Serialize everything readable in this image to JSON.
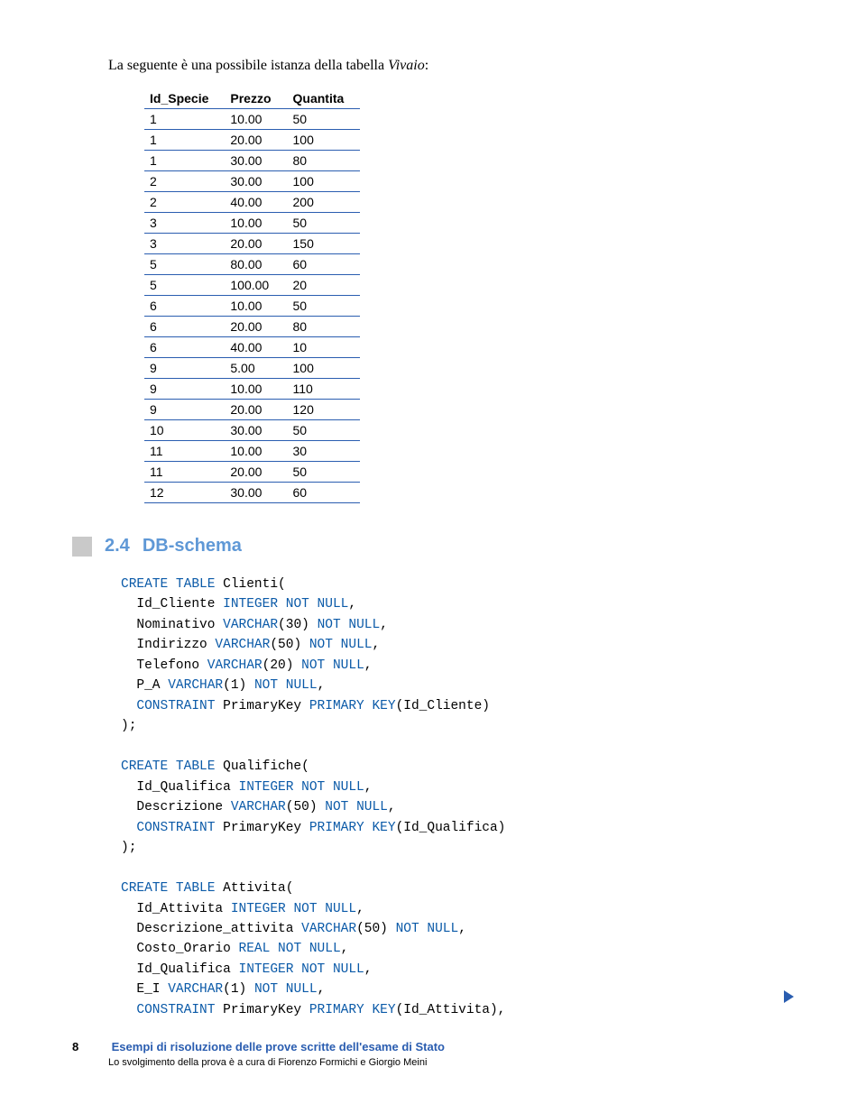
{
  "intro": {
    "prefix": "La seguente è una possibile istanza della tabella ",
    "italic": "Vivaio",
    "suffix": ":"
  },
  "table": {
    "headers": [
      "Id_Specie",
      "Prezzo",
      "Quantita"
    ],
    "rows": [
      [
        "1",
        "10.00",
        "50"
      ],
      [
        "1",
        "20.00",
        "100"
      ],
      [
        "1",
        "30.00",
        "80"
      ],
      [
        "2",
        "30.00",
        "100"
      ],
      [
        "2",
        "40.00",
        "200"
      ],
      [
        "3",
        "10.00",
        "50"
      ],
      [
        "3",
        "20.00",
        "150"
      ],
      [
        "5",
        "80.00",
        "60"
      ],
      [
        "5",
        "100.00",
        "20"
      ],
      [
        "6",
        "10.00",
        "50"
      ],
      [
        "6",
        "20.00",
        "80"
      ],
      [
        "6",
        "40.00",
        "10"
      ],
      [
        "9",
        "5.00",
        "100"
      ],
      [
        "9",
        "10.00",
        "110"
      ],
      [
        "9",
        "20.00",
        "120"
      ],
      [
        "10",
        "30.00",
        "50"
      ],
      [
        "11",
        "10.00",
        "30"
      ],
      [
        "11",
        "20.00",
        "50"
      ],
      [
        "12",
        "30.00",
        "60"
      ]
    ]
  },
  "section": {
    "number": "2.4",
    "title": "DB-schema"
  },
  "code": {
    "lines": [
      [
        [
          "kw",
          "CREATE TABLE"
        ],
        [
          "",
          " Clienti("
        ]
      ],
      [
        [
          "",
          "  Id_Cliente "
        ],
        [
          "kw",
          "INTEGER NOT NULL"
        ],
        [
          "",
          ","
        ]
      ],
      [
        [
          "",
          "  Nominativo "
        ],
        [
          "kw",
          "VARCHAR"
        ],
        [
          "",
          "(30) "
        ],
        [
          "kw",
          "NOT NULL"
        ],
        [
          "",
          ","
        ]
      ],
      [
        [
          "",
          "  Indirizzo "
        ],
        [
          "kw",
          "VARCHAR"
        ],
        [
          "",
          "(50) "
        ],
        [
          "kw",
          "NOT NULL"
        ],
        [
          "",
          ","
        ]
      ],
      [
        [
          "",
          "  Telefono "
        ],
        [
          "kw",
          "VARCHAR"
        ],
        [
          "",
          "(20) "
        ],
        [
          "kw",
          "NOT NULL"
        ],
        [
          "",
          ","
        ]
      ],
      [
        [
          "",
          "  P_A "
        ],
        [
          "kw",
          "VARCHAR"
        ],
        [
          "",
          "(1) "
        ],
        [
          "kw",
          "NOT NULL"
        ],
        [
          "",
          ","
        ]
      ],
      [
        [
          "",
          "  "
        ],
        [
          "kw",
          "CONSTRAINT"
        ],
        [
          "",
          " PrimaryKey "
        ],
        [
          "kw",
          "PRIMARY KEY"
        ],
        [
          "",
          "(Id_Cliente)"
        ]
      ],
      [
        [
          "",
          ");"
        ]
      ],
      [
        [
          "",
          ""
        ]
      ],
      [
        [
          "kw",
          "CREATE TABLE"
        ],
        [
          "",
          " Qualifiche("
        ]
      ],
      [
        [
          "",
          "  Id_Qualifica "
        ],
        [
          "kw",
          "INTEGER NOT NULL"
        ],
        [
          "",
          ","
        ]
      ],
      [
        [
          "",
          "  Descrizione "
        ],
        [
          "kw",
          "VARCHAR"
        ],
        [
          "",
          "(50) "
        ],
        [
          "kw",
          "NOT NULL"
        ],
        [
          "",
          ","
        ]
      ],
      [
        [
          "",
          "  "
        ],
        [
          "kw",
          "CONSTRAINT"
        ],
        [
          "",
          " PrimaryKey "
        ],
        [
          "kw",
          "PRIMARY KEY"
        ],
        [
          "",
          "(Id_Qualifica)"
        ]
      ],
      [
        [
          "",
          ");"
        ]
      ],
      [
        [
          "",
          ""
        ]
      ],
      [
        [
          "kw",
          "CREATE TABLE"
        ],
        [
          "",
          " Attivita("
        ]
      ],
      [
        [
          "",
          "  Id_Attivita "
        ],
        [
          "kw",
          "INTEGER NOT NULL"
        ],
        [
          "",
          ","
        ]
      ],
      [
        [
          "",
          "  Descrizione_attivita "
        ],
        [
          "kw",
          "VARCHAR"
        ],
        [
          "",
          "(50) "
        ],
        [
          "kw",
          "NOT NULL"
        ],
        [
          "",
          ","
        ]
      ],
      [
        [
          "",
          "  Costo_Orario "
        ],
        [
          "kw",
          "REAL NOT NULL"
        ],
        [
          "",
          ","
        ]
      ],
      [
        [
          "",
          "  Id_Qualifica "
        ],
        [
          "kw",
          "INTEGER NOT NULL"
        ],
        [
          "",
          ","
        ]
      ],
      [
        [
          "",
          "  E_I "
        ],
        [
          "kw",
          "VARCHAR"
        ],
        [
          "",
          "(1) "
        ],
        [
          "kw",
          "NOT NULL"
        ],
        [
          "",
          ","
        ]
      ],
      [
        [
          "",
          "  "
        ],
        [
          "kw",
          "CONSTRAINT"
        ],
        [
          "",
          " PrimaryKey "
        ],
        [
          "kw",
          "PRIMARY KEY"
        ],
        [
          "",
          "(Id_Attivita),"
        ]
      ]
    ]
  },
  "footer": {
    "page_number": "8",
    "title": "Esempi di risoluzione delle prove scritte dell'esame di Stato",
    "credit": "Lo svolgimento della prova è a cura di Fiorenzo Formichi e Giorgio Meini"
  }
}
